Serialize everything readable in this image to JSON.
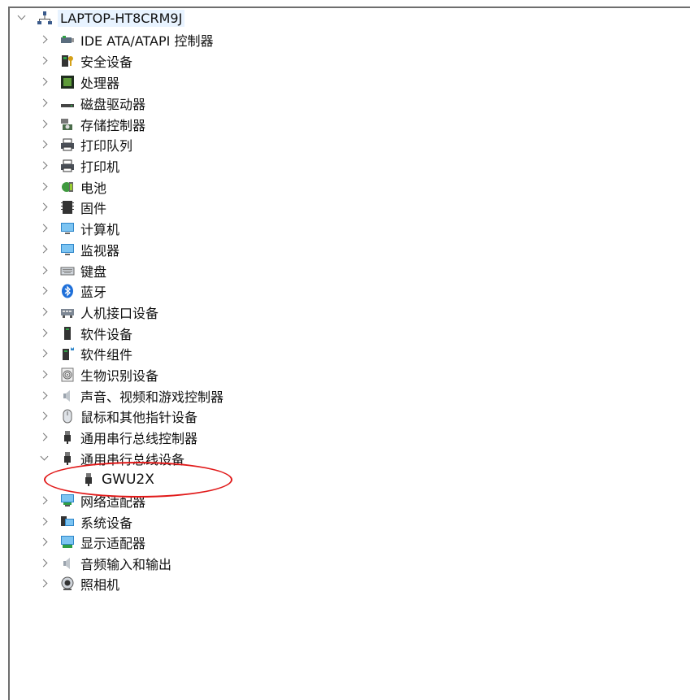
{
  "device_manager": {
    "root": {
      "label": "LAPTOP-HT8CRM9J",
      "icon": "computer-network-icon",
      "expanded": true
    },
    "categories": [
      {
        "label": "IDE ATA/ATAPI 控制器",
        "icon": "ide-controller-icon",
        "expanded": false
      },
      {
        "label": "安全设备",
        "icon": "security-key-icon",
        "expanded": false
      },
      {
        "label": "处理器",
        "icon": "processor-icon",
        "expanded": false
      },
      {
        "label": "磁盘驱动器",
        "icon": "disk-drive-icon",
        "expanded": false
      },
      {
        "label": "存储控制器",
        "icon": "storage-controller-icon",
        "expanded": false
      },
      {
        "label": "打印队列",
        "icon": "print-queue-icon",
        "expanded": false
      },
      {
        "label": "打印机",
        "icon": "printer-icon",
        "expanded": false
      },
      {
        "label": "电池",
        "icon": "battery-icon",
        "expanded": false
      },
      {
        "label": "固件",
        "icon": "firmware-icon",
        "expanded": false
      },
      {
        "label": "计算机",
        "icon": "computer-icon",
        "expanded": false
      },
      {
        "label": "监视器",
        "icon": "monitor-icon",
        "expanded": false
      },
      {
        "label": "键盘",
        "icon": "keyboard-icon",
        "expanded": false
      },
      {
        "label": "蓝牙",
        "icon": "bluetooth-icon",
        "expanded": false
      },
      {
        "label": "人机接口设备",
        "icon": "hid-icon",
        "expanded": false
      },
      {
        "label": "软件设备",
        "icon": "software-device-icon",
        "expanded": false
      },
      {
        "label": "软件组件",
        "icon": "software-component-icon",
        "expanded": false
      },
      {
        "label": "生物识别设备",
        "icon": "fingerprint-icon",
        "expanded": false
      },
      {
        "label": "声音、视频和游戏控制器",
        "icon": "speaker-icon",
        "expanded": false
      },
      {
        "label": "鼠标和其他指针设备",
        "icon": "mouse-icon",
        "expanded": false
      },
      {
        "label": "通用串行总线控制器",
        "icon": "usb-icon",
        "expanded": false
      },
      {
        "label": "通用串行总线设备",
        "icon": "usb-icon",
        "expanded": true,
        "children": [
          {
            "label": "GWU2X",
            "icon": "usb-icon"
          }
        ]
      },
      {
        "label": "网络适配器",
        "icon": "network-adapter-icon",
        "expanded": false
      },
      {
        "label": "系统设备",
        "icon": "system-device-icon",
        "expanded": false
      },
      {
        "label": "显示适配器",
        "icon": "display-adapter-icon",
        "expanded": false
      },
      {
        "label": "音频输入和输出",
        "icon": "speaker-icon",
        "expanded": false
      },
      {
        "label": "照相机",
        "icon": "camera-icon",
        "expanded": false
      }
    ]
  },
  "annotation": {
    "color": "#e11a1a",
    "target": "GWU2X"
  }
}
